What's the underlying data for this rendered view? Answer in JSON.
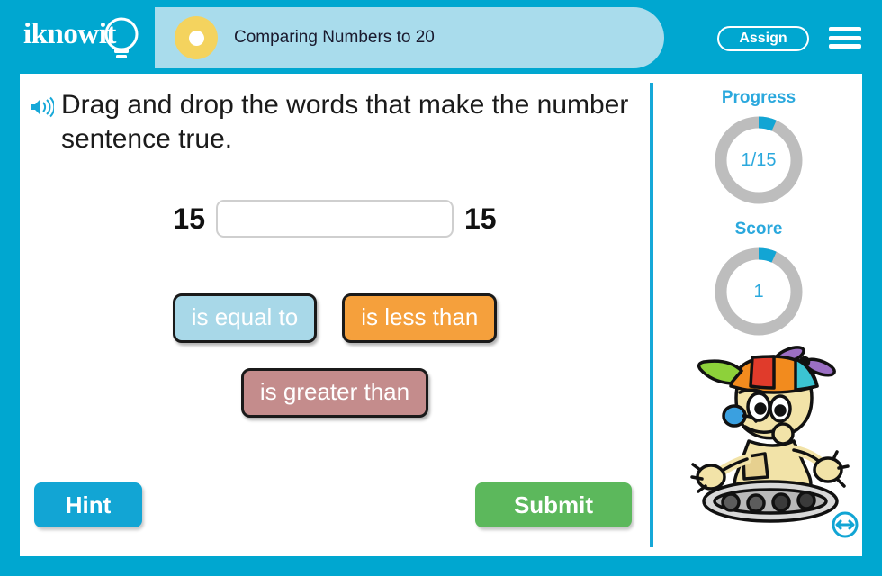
{
  "header": {
    "logo_text": "iknowit",
    "logo_icon": "lightbulb-icon",
    "title": "Comparing Numbers to 20",
    "assign_label": "Assign",
    "menu_icon": "hamburger-menu-icon",
    "bar_color": "#00a7d0",
    "pill_color": "#a9dcec",
    "dot_color": "#f4d35e"
  },
  "question": {
    "audio_icon": "speaker-icon",
    "text": "Drag and drop the words that make the number sentence true."
  },
  "sentence": {
    "left_number": "15",
    "right_number": "15",
    "dropzone_value": "",
    "dropzone_placeholder": ""
  },
  "tiles": [
    {
      "label": "is equal to",
      "color": "#a8d8e8"
    },
    {
      "label": "is less than",
      "color": "#f5a03c"
    },
    {
      "label": "is greater than",
      "color": "#c48c8c"
    }
  ],
  "actions": {
    "hint_label": "Hint",
    "hint_color": "#12a5d4",
    "submit_label": "Submit",
    "submit_color": "#5cb85c"
  },
  "panel": {
    "progress_label": "Progress",
    "progress_value": "1/15",
    "progress_current": 1,
    "progress_total": 15,
    "score_label": "Score",
    "score_value": "1",
    "ring_track_color": "#bdbdbd",
    "ring_fill_color": "#12a5d4",
    "accent_color": "#2aa8dd",
    "mascot_icon": "robot-mascot-icon",
    "resize_icon": "resize-horizontal-icon"
  }
}
